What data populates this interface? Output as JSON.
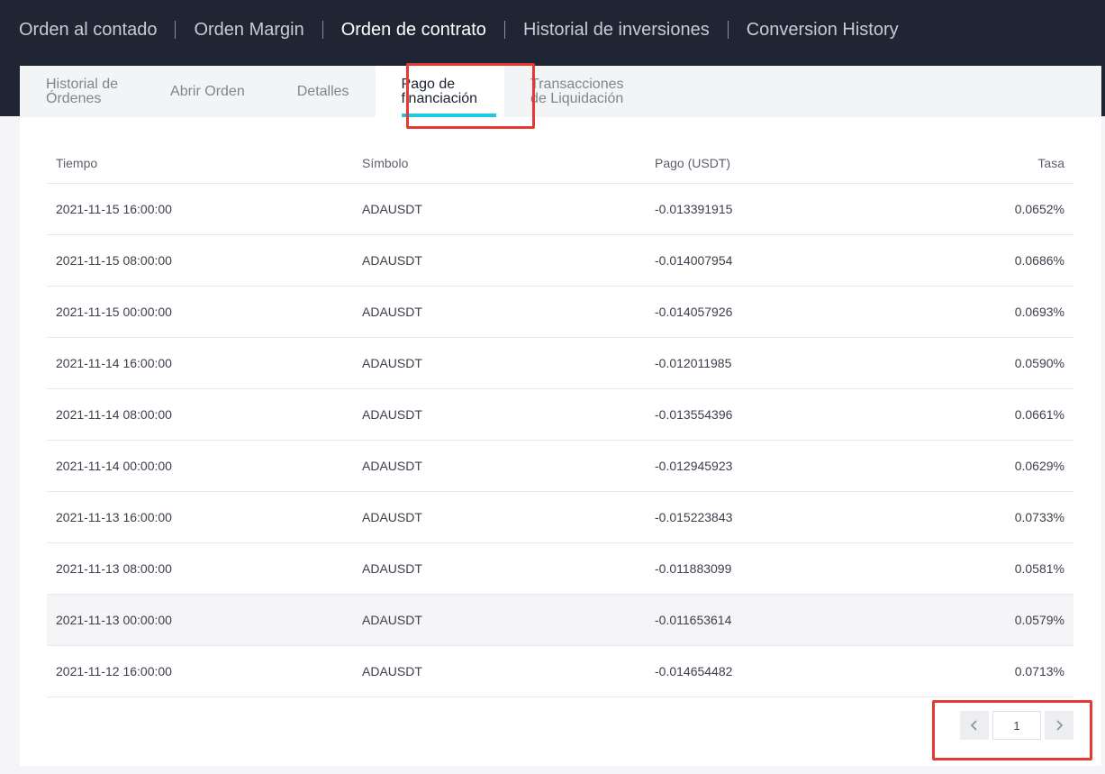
{
  "topnav": {
    "items": [
      {
        "label": "Orden al contado",
        "active": false
      },
      {
        "label": "Orden Margin",
        "active": false
      },
      {
        "label": "Orden de contrato",
        "active": true
      },
      {
        "label": "Historial de inversiones",
        "active": false
      },
      {
        "label": "Conversion History",
        "active": false
      }
    ]
  },
  "tabs": {
    "items": [
      {
        "label": "Historial de\nÓrdenes"
      },
      {
        "label": "Abrir Orden"
      },
      {
        "label": "Detalles"
      },
      {
        "label": "Pago de\nfinanciación"
      },
      {
        "label": "Transacciones\nde Liquidación"
      }
    ],
    "active_index": 3
  },
  "table": {
    "headers": {
      "time": "Tiempo",
      "symbol": "Símbolo",
      "payment": "Pago (USDT)",
      "rate": "Tasa"
    },
    "rows": [
      {
        "time": "2021-11-15 16:00:00",
        "symbol": "ADAUSDT",
        "payment": "-0.013391915",
        "rate": "0.0652%"
      },
      {
        "time": "2021-11-15 08:00:00",
        "symbol": "ADAUSDT",
        "payment": "-0.014007954",
        "rate": "0.0686%"
      },
      {
        "time": "2021-11-15 00:00:00",
        "symbol": "ADAUSDT",
        "payment": "-0.014057926",
        "rate": "0.0693%"
      },
      {
        "time": "2021-11-14 16:00:00",
        "symbol": "ADAUSDT",
        "payment": "-0.012011985",
        "rate": "0.0590%"
      },
      {
        "time": "2021-11-14 08:00:00",
        "symbol": "ADAUSDT",
        "payment": "-0.013554396",
        "rate": "0.0661%"
      },
      {
        "time": "2021-11-14 00:00:00",
        "symbol": "ADAUSDT",
        "payment": "-0.012945923",
        "rate": "0.0629%"
      },
      {
        "time": "2021-11-13 16:00:00",
        "symbol": "ADAUSDT",
        "payment": "-0.015223843",
        "rate": "0.0733%"
      },
      {
        "time": "2021-11-13 08:00:00",
        "symbol": "ADAUSDT",
        "payment": "-0.011883099",
        "rate": "0.0581%"
      },
      {
        "time": "2021-11-13 00:00:00",
        "symbol": "ADAUSDT",
        "payment": "-0.011653614",
        "rate": "0.0579%"
      },
      {
        "time": "2021-11-12 16:00:00",
        "symbol": "ADAUSDT",
        "payment": "-0.014654482",
        "rate": "0.0713%"
      }
    ]
  },
  "pagination": {
    "prev_icon": "chevron-left-icon",
    "next_icon": "chevron-right-icon",
    "current_page": "1"
  },
  "colors": {
    "header_bg": "#1f2533",
    "accent": "#1ec8e0",
    "highlight": "#e53935"
  }
}
